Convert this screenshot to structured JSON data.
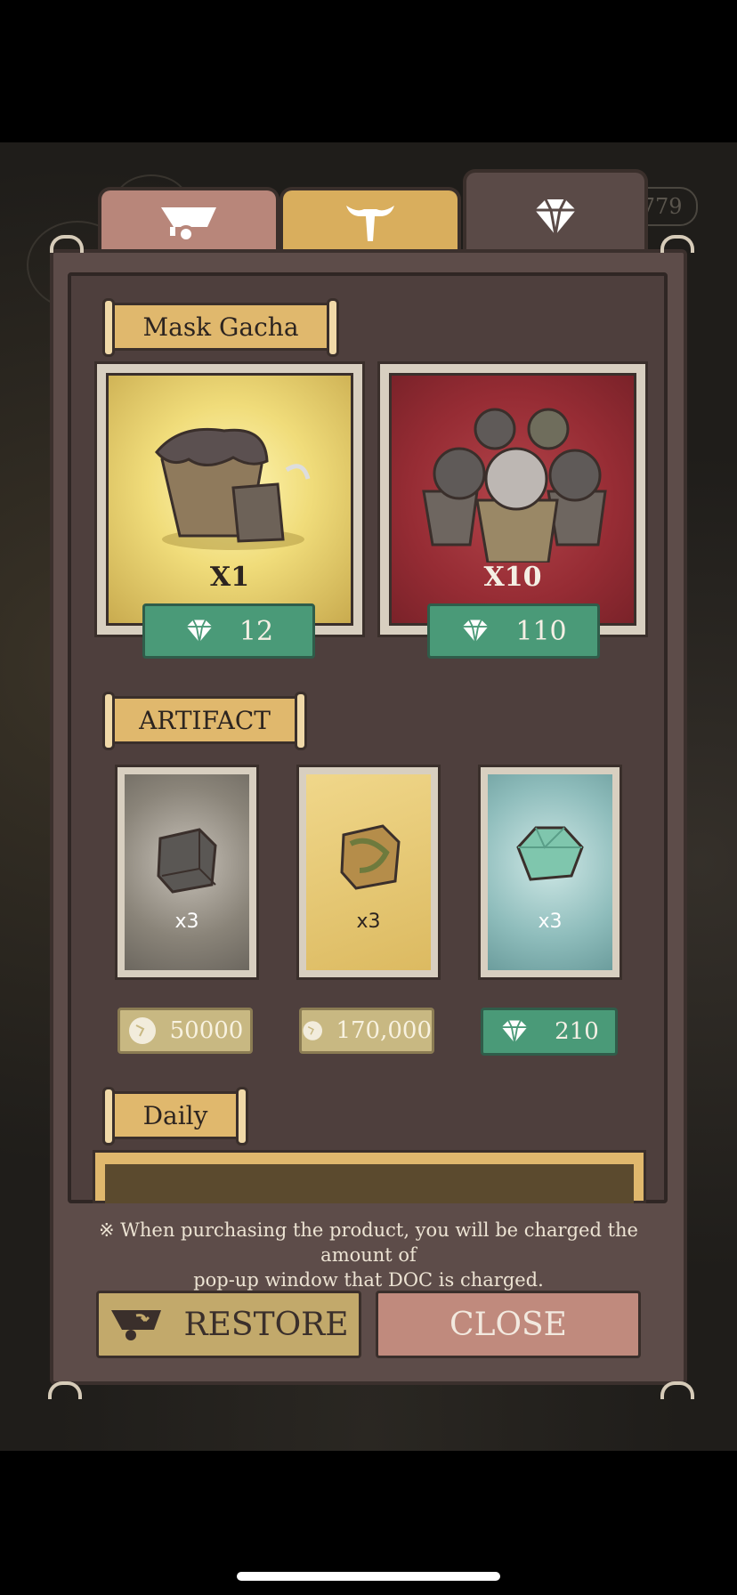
{
  "hud": {
    "counter": "1779"
  },
  "tabs": [
    {
      "icon": "cart-icon"
    },
    {
      "icon": "skull-icon"
    },
    {
      "icon": "gem-icon",
      "active": true
    }
  ],
  "mask_gacha": {
    "title": "Mask Gacha",
    "items": [
      {
        "multiplier": "X1",
        "price": "12",
        "currency": "gem-icon"
      },
      {
        "multiplier": "X10",
        "price": "110",
        "currency": "gem-icon"
      }
    ]
  },
  "artifact": {
    "title": "ARTIFACT",
    "items": [
      {
        "multiplier": "x3",
        "price": "50000",
        "currency": "stone-icon"
      },
      {
        "multiplier": "x3",
        "price": "170,000",
        "currency": "stone-icon"
      },
      {
        "multiplier": "x3",
        "price": "210",
        "currency": "gem-icon"
      }
    ]
  },
  "daily": {
    "title": "Daily"
  },
  "disclaimer": {
    "line1": "※ When purchasing the product, you will be charged the amount of",
    "line2": "pop-up window that DOC is charged."
  },
  "buttons": {
    "restore": "RESTORE",
    "close": "CLOSE"
  },
  "colors": {
    "panel": "#5d4c49",
    "price_green": "#4a9a78",
    "price_stone": "#c8b882",
    "label_gold": "#e0b86d",
    "close_button": "#c08a7d",
    "restore_button": "#c2a96b"
  }
}
